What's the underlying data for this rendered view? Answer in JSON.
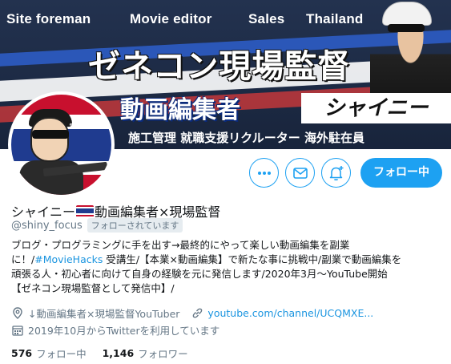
{
  "banner": {
    "top_words": [
      "Site foreman",
      "Movie editor",
      "Sales",
      "Thailand"
    ],
    "title": "ゼネコン現場監督",
    "subtitle": "動画編集者",
    "name_box": "シャイニー",
    "roles": "施工管理  就職支援リクルーター  海外駐在員"
  },
  "avatar": {
    "tag": "ช่ายนี่"
  },
  "actions": {
    "follow_label": "フォロー中",
    "more_icon": "more-icon",
    "message_icon": "mail-icon",
    "notify_icon": "bell-plus-icon"
  },
  "profile": {
    "name_before_flag": "シャイニー",
    "name_after_flag": "動画編集者×現場監督",
    "handle": "@shiny_focus",
    "follows_you": "フォローされています",
    "bio_lines": [
      "ブログ・プログラミングに手を出す→最終的にやって楽しい動画編集を副業",
      "に！/",
      "#MovieHacks",
      " 受講生/【本業×動画編集】で新たな事に挑戦中/副業で動画編集を",
      "頑張る人・初心者に向けて自身の経験を元に発信します/2020年3月〜YouTube開始",
      "【ゼネコン現場監督として発信中】/"
    ],
    "location": "↓動画編集者×現場監督YouTuber",
    "url": "youtube.com/channel/UCQMXE...",
    "joined": "2019年10月からTwitterを利用しています",
    "following_count": "576",
    "following_label": "フォロー中",
    "followers_count": "1,146",
    "followers_label": "フォロワー"
  },
  "colors": {
    "accent": "#1da1f2",
    "link": "#1b95e0",
    "secondary_text": "#657786",
    "thai_red": "#c8102e",
    "thai_blue": "#1f3b8f"
  }
}
